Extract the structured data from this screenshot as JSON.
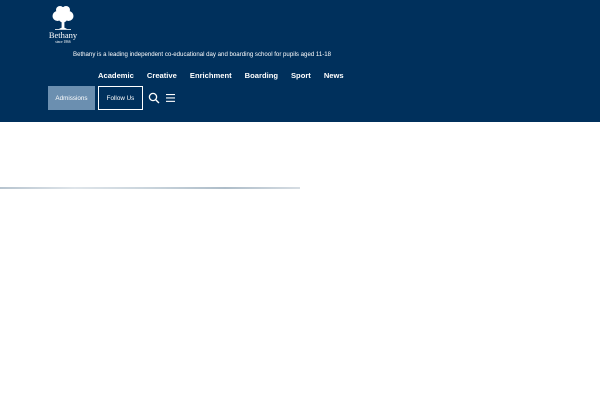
{
  "brand": {
    "name": "Bethany",
    "since": "since 1866",
    "tagline": "Bethany is a leading independent co-educational day and boarding school for pupils aged 11-18"
  },
  "nav": {
    "items": [
      "Academic",
      "Creative",
      "Enrichment",
      "Boarding",
      "Sport",
      "News"
    ]
  },
  "actions": {
    "admissions_label": "Admissions",
    "follow_label": "Follow Us"
  },
  "icons": {
    "logo": "oak-tree-icon",
    "search": "search-icon",
    "menu": "hamburger-menu-icon"
  },
  "colors": {
    "header_bg": "#00305c",
    "admissions_bg": "#6b8fb0",
    "text": "#ffffff"
  }
}
